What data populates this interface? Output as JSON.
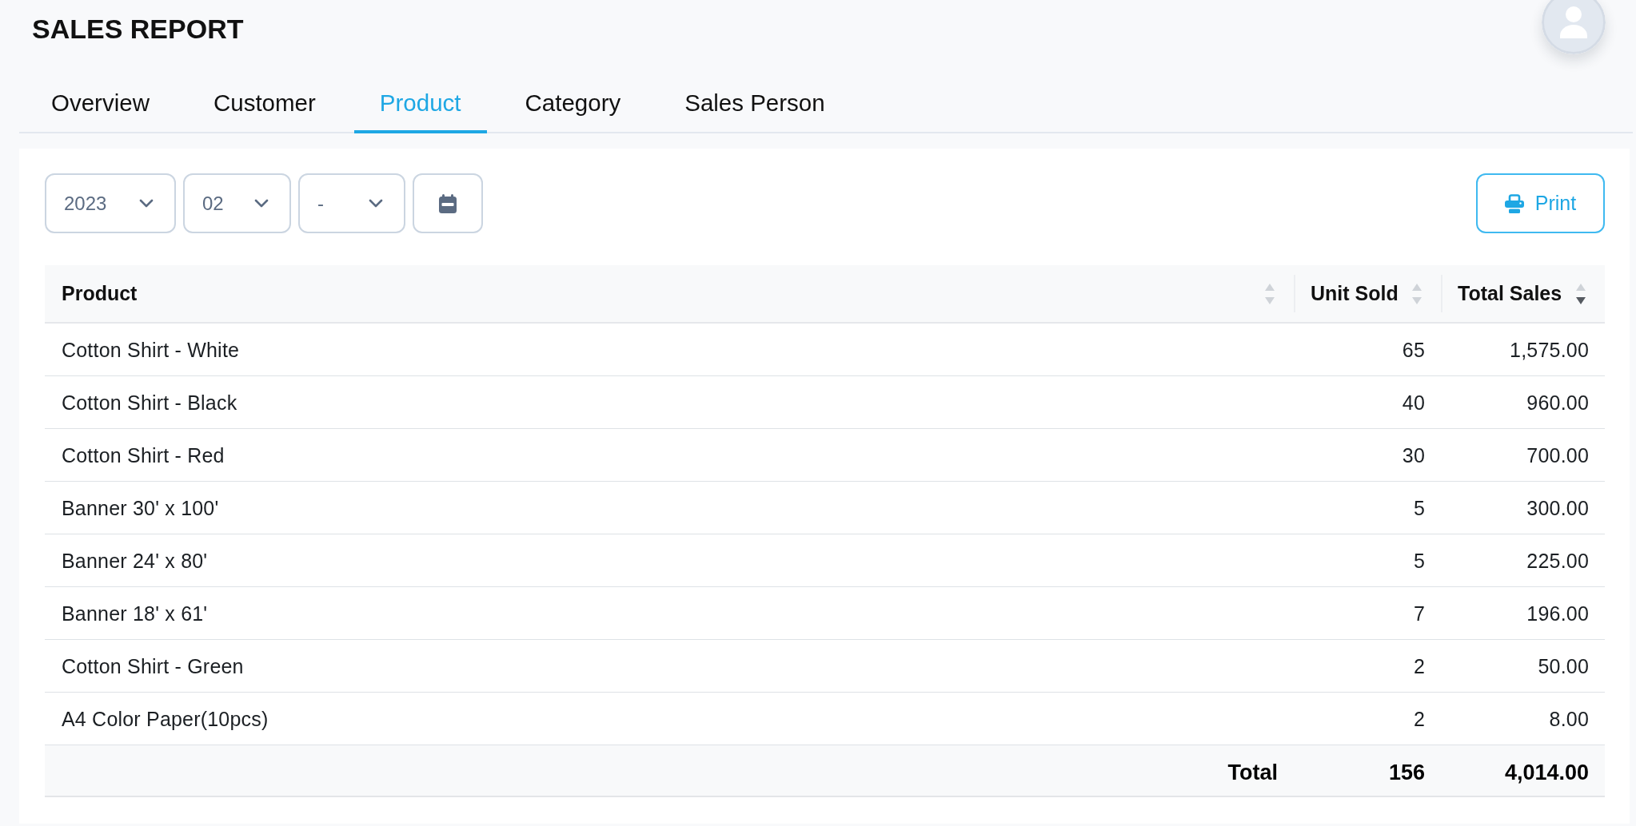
{
  "page": {
    "title": "SALES REPORT"
  },
  "tabs": [
    {
      "label": "Overview",
      "selected": false
    },
    {
      "label": "Customer",
      "selected": false
    },
    {
      "label": "Product",
      "selected": true
    },
    {
      "label": "Category",
      "selected": false
    },
    {
      "label": "Sales Person",
      "selected": false
    }
  ],
  "filters": [
    {
      "value": "2023"
    },
    {
      "value": "02"
    },
    {
      "value": "-"
    }
  ],
  "print_button": {
    "label": "Print"
  },
  "table": {
    "columns": [
      {
        "label": "Product",
        "sorted_descending": false
      },
      {
        "label": "Unit Sold",
        "sorted_descending": false
      },
      {
        "label": "Total Sales",
        "sorted_descending": true
      }
    ],
    "rows": [
      [
        "Cotton Shirt - White",
        "65",
        "1,575.00"
      ],
      [
        "Cotton Shirt - Black",
        "40",
        "960.00"
      ],
      [
        "Cotton Shirt - Red",
        "30",
        "700.00"
      ],
      [
        "Banner 30' x 100'",
        "5",
        "300.00"
      ],
      [
        "Banner 24' x 80'",
        "5",
        "225.00"
      ],
      [
        "Banner 18' x 61'",
        "7",
        "196.00"
      ],
      [
        "Cotton Shirt - Green",
        "2",
        "50.00"
      ],
      [
        "A4 Color Paper(10pcs)",
        "2",
        "8.00"
      ]
    ],
    "total": [
      "Total",
      "156",
      "4,014.00"
    ]
  }
}
